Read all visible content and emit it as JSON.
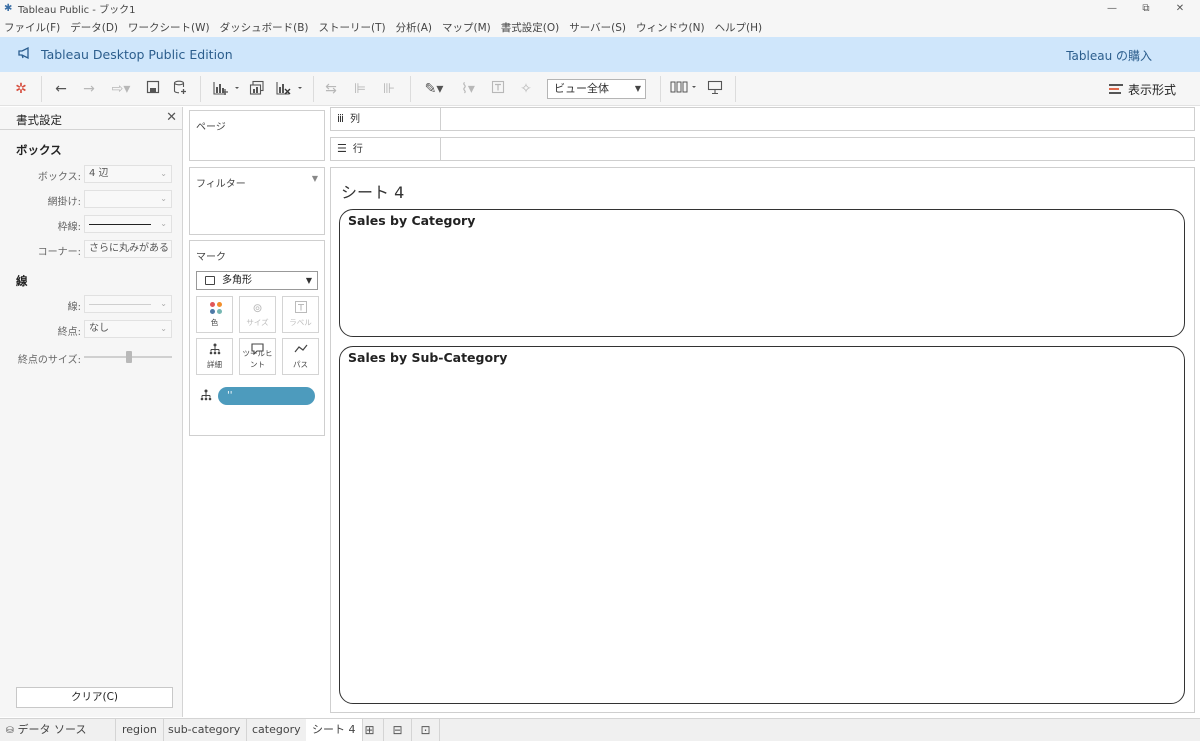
{
  "window": {
    "title": "Tableau Public - ブック1",
    "minimize_glyph": "—",
    "restore_glyph": "⧉",
    "close_glyph": "✕"
  },
  "menu": [
    "ファイル(F)",
    "データ(D)",
    "ワークシート(W)",
    "ダッシュボード(B)",
    "ストーリー(T)",
    "分析(A)",
    "マップ(M)",
    "書式設定(O)",
    "サーバー(S)",
    "ウィンドウ(N)",
    "ヘルプ(H)"
  ],
  "banner": {
    "title": "Tableau Desktop Public Edition",
    "buy": "Tableau の購入"
  },
  "toolbar": {
    "view_select": "ビュー全体",
    "format_label": "表示形式"
  },
  "format_pane": {
    "title": "書式設定",
    "close": "✕",
    "box_section": "ボックス",
    "box_label": "ボックス:",
    "box_value": "4 辺",
    "shading_label": "網掛け:",
    "shading_value": "",
    "border_label": "枠線:",
    "corner_label": "コーナー:",
    "corner_value": "さらに丸みがある",
    "line_section": "線",
    "line_label": "線:",
    "endpoint_label": "終点:",
    "endpoint_value": "なし",
    "endpoint_size_label": "終点のサイズ:",
    "clear_button": "クリア(C)"
  },
  "cards": {
    "pages": "ページ",
    "filters": "フィルター",
    "marks": "マーク",
    "mark_type": "多角形",
    "buttons": {
      "color": "色",
      "size": "サイズ",
      "label": "ラベル",
      "detail": "詳細",
      "tooltip": "ツールヒント",
      "path": "パス"
    },
    "pill_text": "''"
  },
  "shelves": {
    "columns": "列",
    "rows": "行"
  },
  "canvas": {
    "sheet_title": "シート 4",
    "zone1_title": "Sales by Category",
    "zone2_title": "Sales by Sub-Category"
  },
  "tabs": {
    "data_source": "データ ソース",
    "sheets": [
      "region",
      "sub-category",
      "category",
      "シート 4"
    ]
  },
  "colors": {
    "banner_bg": "#cfe6fb",
    "banner_text": "#2c5e8d",
    "pill": "#4d9bbd",
    "dot_red": "#e15759",
    "dot_orange": "#f28e2b",
    "dot_blue": "#4e79a7",
    "dot_teal": "#76b7b2"
  }
}
